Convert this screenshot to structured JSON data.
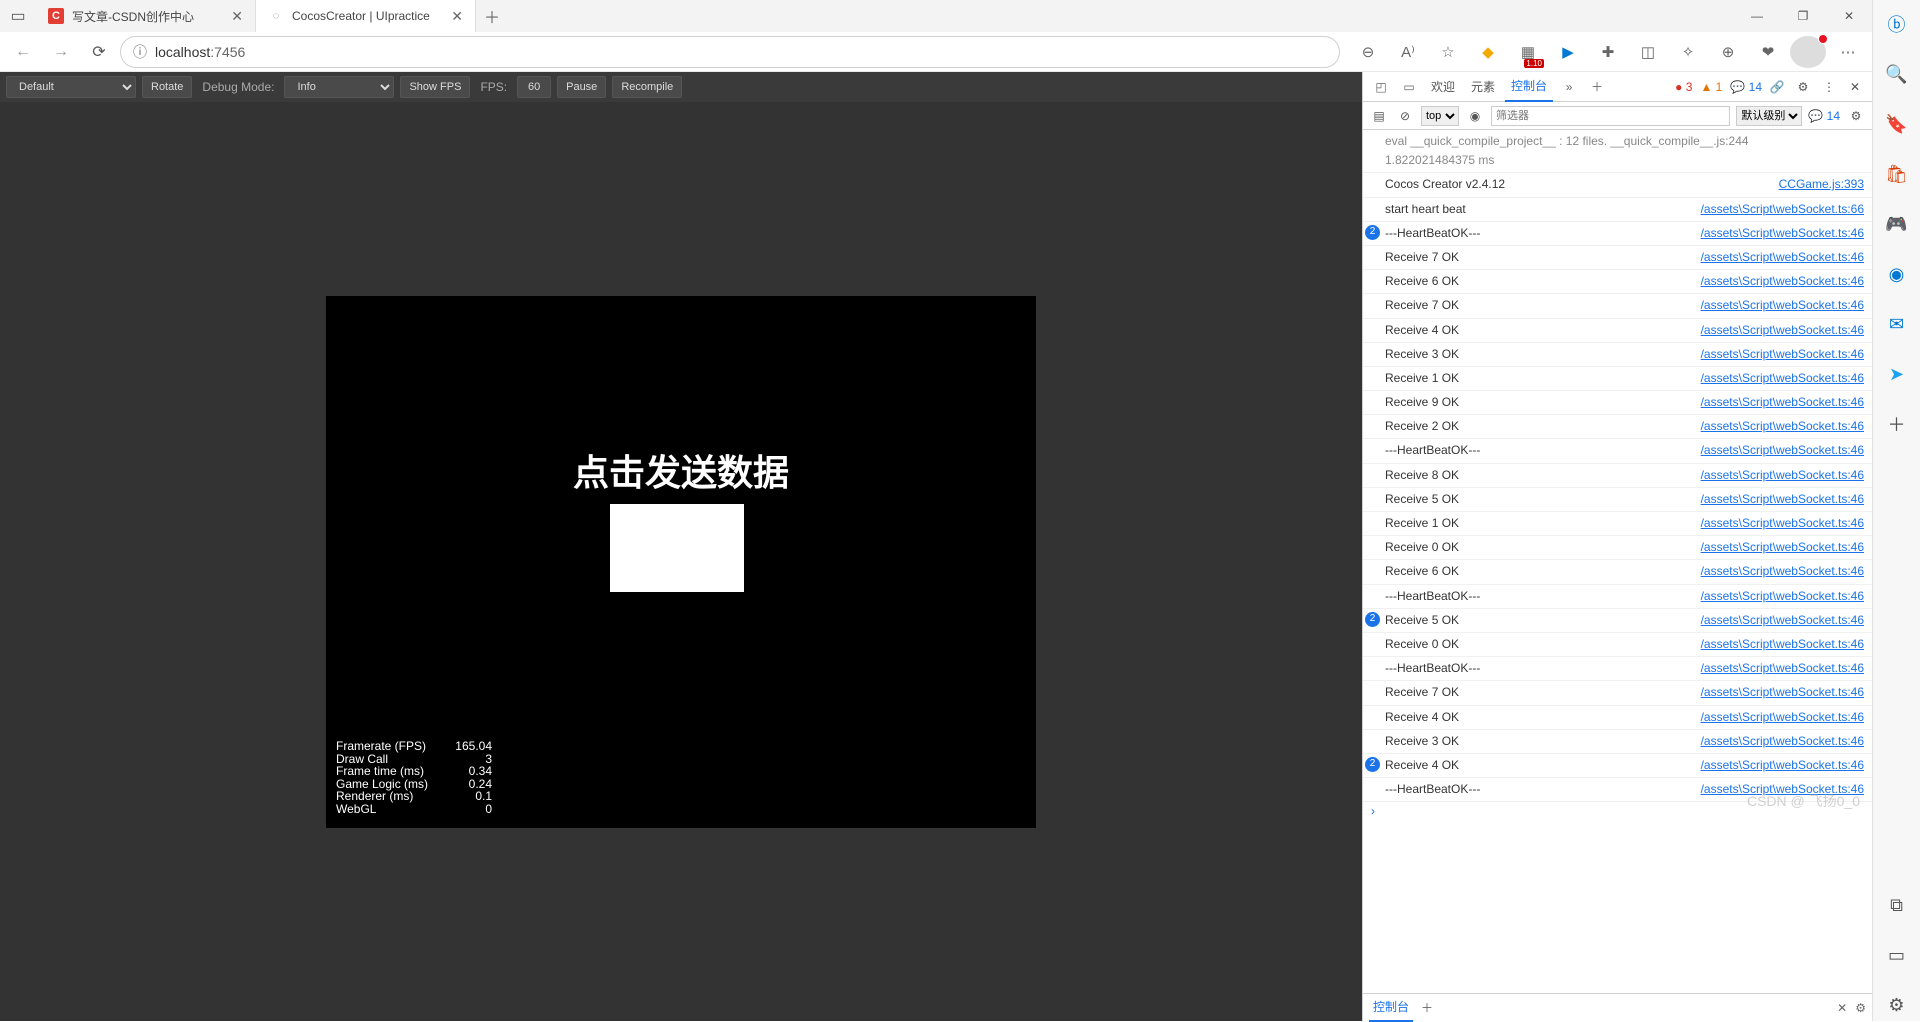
{
  "browser": {
    "tabs": [
      {
        "title": "写文章-CSDN创作中心",
        "favicon": "C",
        "favcolor": "#e33e33"
      },
      {
        "title": "CocosCreator | UIpractice",
        "favicon": "◌",
        "favcolor": "#888"
      }
    ],
    "url_prefix": "localhost",
    "url_port": ":7456",
    "badge_110": "1.10"
  },
  "game": {
    "toolbar": {
      "preset": "Default",
      "rotate": "Rotate",
      "debugmode_label": "Debug Mode:",
      "debugmode_value": "Info",
      "showfps": "Show FPS",
      "fps_label": "FPS:",
      "fps_value": "60",
      "pause": "Pause",
      "recompile": "Recompile"
    },
    "headline": "点击发送数据",
    "stats": [
      {
        "k": "Framerate (FPS)",
        "v": "165.04"
      },
      {
        "k": "Draw Call",
        "v": "3"
      },
      {
        "k": "Frame time (ms)",
        "v": "0.34"
      },
      {
        "k": "Game Logic (ms)",
        "v": "0.24"
      },
      {
        "k": "Renderer (ms)",
        "v": "0.1"
      },
      {
        "k": "WebGL",
        "v": "0"
      }
    ]
  },
  "devtools": {
    "tabs": {
      "welcome": "欢迎",
      "elements": "元素",
      "console": "控制台"
    },
    "counts": {
      "errors": "3",
      "warnings": "1",
      "info": "14"
    },
    "filter": {
      "context": "top",
      "placeholder": "筛选器",
      "level": "默认级别",
      "hidden": "14"
    },
    "drawer": {
      "console": "控制台"
    },
    "log_pre": [
      {
        "msg": "eval __quick_compile_project__ : 12 files.  __quick_compile__.js:244",
        "src": ""
      },
      {
        "msg": "1.822021484375 ms",
        "src": ""
      }
    ],
    "logs": [
      {
        "msg": "Cocos Creator v2.4.12",
        "src": "CCGame.js:393"
      },
      {
        "msg": "start heart beat",
        "src": "/assets\\Script\\webSocket.ts:66"
      },
      {
        "msg": "---HeartBeatOK---",
        "src": "/assets\\Script\\webSocket.ts:46",
        "badge": "2"
      },
      {
        "msg": "Receive 7 OK",
        "src": "/assets\\Script\\webSocket.ts:46"
      },
      {
        "msg": "Receive 6 OK",
        "src": "/assets\\Script\\webSocket.ts:46"
      },
      {
        "msg": "Receive 7 OK",
        "src": "/assets\\Script\\webSocket.ts:46"
      },
      {
        "msg": "Receive 4 OK",
        "src": "/assets\\Script\\webSocket.ts:46"
      },
      {
        "msg": "Receive 3 OK",
        "src": "/assets\\Script\\webSocket.ts:46"
      },
      {
        "msg": "Receive 1 OK",
        "src": "/assets\\Script\\webSocket.ts:46"
      },
      {
        "msg": "Receive 9 OK",
        "src": "/assets\\Script\\webSocket.ts:46"
      },
      {
        "msg": "Receive 2 OK",
        "src": "/assets\\Script\\webSocket.ts:46"
      },
      {
        "msg": "---HeartBeatOK---",
        "src": "/assets\\Script\\webSocket.ts:46"
      },
      {
        "msg": "Receive 8 OK",
        "src": "/assets\\Script\\webSocket.ts:46"
      },
      {
        "msg": "Receive 5 OK",
        "src": "/assets\\Script\\webSocket.ts:46"
      },
      {
        "msg": "Receive 1 OK",
        "src": "/assets\\Script\\webSocket.ts:46"
      },
      {
        "msg": "Receive 0 OK",
        "src": "/assets\\Script\\webSocket.ts:46"
      },
      {
        "msg": "Receive 6 OK",
        "src": "/assets\\Script\\webSocket.ts:46"
      },
      {
        "msg": "---HeartBeatOK---",
        "src": "/assets\\Script\\webSocket.ts:46"
      },
      {
        "msg": "Receive 5 OK",
        "src": "/assets\\Script\\webSocket.ts:46",
        "badge": "2"
      },
      {
        "msg": "Receive 0 OK",
        "src": "/assets\\Script\\webSocket.ts:46"
      },
      {
        "msg": "---HeartBeatOK---",
        "src": "/assets\\Script\\webSocket.ts:46"
      },
      {
        "msg": "Receive 7 OK",
        "src": "/assets\\Script\\webSocket.ts:46"
      },
      {
        "msg": "Receive 4 OK",
        "src": "/assets\\Script\\webSocket.ts:46"
      },
      {
        "msg": "Receive 3 OK",
        "src": "/assets\\Script\\webSocket.ts:46"
      },
      {
        "msg": "Receive 4 OK",
        "src": "/assets\\Script\\webSocket.ts:46",
        "badge": "2"
      },
      {
        "msg": "---HeartBeatOK---",
        "src": "/assets\\Script\\webSocket.ts:46"
      }
    ]
  },
  "watermark": "CSDN @ 飞扬0_0"
}
